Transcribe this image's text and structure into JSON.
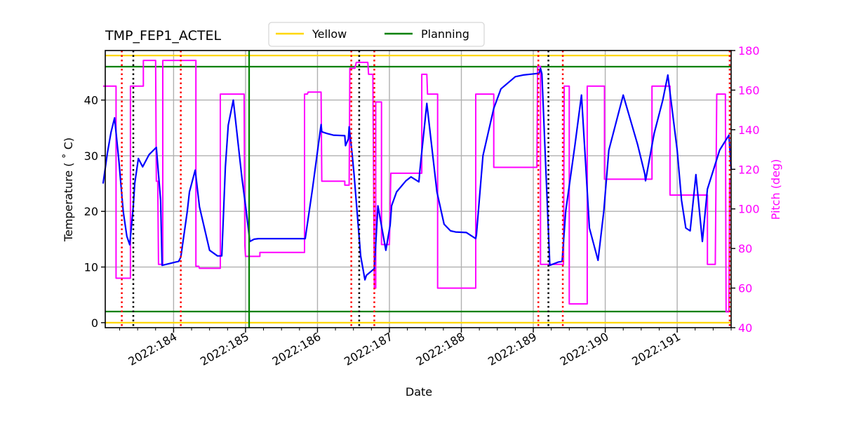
{
  "chart_data": {
    "type": "line",
    "title": "TMP_FEP1_ACTEL",
    "xlabel": "Date",
    "ylabel": "Temperature ($^\\circ$C)",
    "ylabel_display": "Temperature ( ˚ C)",
    "y2label": "Pitch (deg)",
    "xlim": [
      183.05,
      191.75
    ],
    "ylim": [
      -0.9,
      48.9
    ],
    "y2lim": [
      40,
      180
    ],
    "grid": true,
    "legend": {
      "placement": "top-center",
      "entries": [
        {
          "label": "Yellow",
          "color": "#ffd700"
        },
        {
          "label": "Planning",
          "color": "#008000"
        }
      ]
    },
    "x_ticks": [
      {
        "value": 184,
        "label": "2022:184"
      },
      {
        "value": 185,
        "label": "2022:185"
      },
      {
        "value": 186,
        "label": "2022:186"
      },
      {
        "value": 187,
        "label": "2022:187"
      },
      {
        "value": 188,
        "label": "2022:188"
      },
      {
        "value": 189,
        "label": "2022:189"
      },
      {
        "value": 190,
        "label": "2022:190"
      },
      {
        "value": 191,
        "label": "2022:191"
      }
    ],
    "x_minor_step": 0.25,
    "y_ticks": [
      0,
      10,
      20,
      30,
      40
    ],
    "y2_ticks": [
      40,
      60,
      80,
      100,
      120,
      140,
      160,
      180
    ],
    "limit_lines": [
      {
        "name": "yellow-high",
        "value": 48,
        "color": "#ffd700",
        "group": "Yellow"
      },
      {
        "name": "yellow-low",
        "value": 0,
        "color": "#ffd700",
        "group": "Yellow"
      },
      {
        "name": "planning-high",
        "value": 46,
        "color": "#008000",
        "group": "Planning"
      },
      {
        "name": "planning-low",
        "value": 2,
        "color": "#008000",
        "group": "Planning"
      }
    ],
    "vertical_markers": [
      {
        "x": 183.28,
        "style": "red-dotted"
      },
      {
        "x": 183.44,
        "style": "black-dotted"
      },
      {
        "x": 184.1,
        "style": "red-dotted"
      },
      {
        "x": 185.05,
        "style": "green-solid"
      },
      {
        "x": 186.47,
        "style": "red-dotted"
      },
      {
        "x": 186.58,
        "style": "black-dotted"
      },
      {
        "x": 186.79,
        "style": "red-dotted"
      },
      {
        "x": 189.07,
        "style": "red-dotted"
      },
      {
        "x": 189.21,
        "style": "black-dotted"
      },
      {
        "x": 189.41,
        "style": "red-dotted"
      },
      {
        "x": 191.73,
        "style": "red-dotted"
      }
    ],
    "series": [
      {
        "name": "TMP_FEP1_ACTEL",
        "axis": "left",
        "color": "#0000ff",
        "x": [
          183.02,
          183.08,
          183.13,
          183.18,
          183.24,
          183.3,
          183.35,
          183.39,
          183.44,
          183.46,
          183.51,
          183.57,
          183.66,
          183.76,
          183.82,
          183.84,
          184.03,
          184.07,
          184.1,
          184.19,
          184.22,
          184.3,
          184.36,
          184.5,
          184.61,
          184.67,
          184.72,
          184.76,
          184.83,
          184.95,
          184.99,
          185.01,
          185.06,
          185.12,
          185.18,
          185.2,
          185.3,
          185.5,
          185.83,
          185.93,
          186.05,
          186.06,
          186.13,
          186.22,
          186.38,
          186.39,
          186.43,
          186.44,
          186.48,
          186.51,
          186.6,
          186.66,
          186.68,
          186.79,
          186.84,
          186.95,
          187.01,
          187.03,
          187.1,
          187.23,
          187.3,
          187.41,
          187.42,
          187.46,
          187.52,
          187.66,
          187.76,
          187.85,
          187.92,
          188.07,
          188.2,
          188.21,
          188.3,
          188.45,
          188.55,
          188.75,
          188.86,
          189.08,
          189.1,
          189.12,
          189.23,
          189.35,
          189.4,
          189.45,
          189.58,
          189.67,
          189.73,
          189.78,
          189.9,
          189.98,
          190.05,
          190.25,
          190.45,
          190.55,
          190.56,
          190.68,
          190.8,
          190.87,
          191.0,
          191.06,
          191.12,
          191.18,
          191.26,
          191.35,
          191.42,
          191.59,
          191.72,
          191.75
        ],
        "values": [
          25.0,
          30.5,
          34.2,
          36.8,
          29.0,
          20.0,
          15.5,
          14.0,
          21.0,
          25.0,
          29.5,
          28.0,
          30.2,
          31.5,
          22.0,
          10.3,
          10.9,
          11.0,
          11.8,
          20.0,
          23.5,
          27.4,
          20.8,
          13.0,
          12.0,
          12.0,
          28.0,
          35.5,
          40.0,
          26.0,
          22.0,
          20.0,
          14.6,
          15.0,
          15.1,
          15.1,
          15.1,
          15.1,
          15.1,
          24.0,
          35.6,
          34.3,
          34.0,
          33.7,
          33.6,
          31.8,
          33.0,
          35.2,
          30.5,
          26.5,
          12.0,
          7.7,
          8.5,
          9.7,
          21.0,
          13.0,
          17.5,
          21.0,
          23.5,
          25.5,
          26.2,
          25.3,
          27.0,
          32.0,
          39.4,
          23.5,
          17.7,
          16.5,
          16.3,
          16.2,
          15.1,
          15.8,
          30.0,
          38.5,
          42.0,
          44.2,
          44.5,
          44.8,
          45.7,
          44.7,
          10.3,
          10.9,
          11.0,
          20.0,
          32.0,
          40.9,
          28.0,
          17.0,
          11.2,
          20.0,
          31.0,
          40.9,
          32.0,
          26.7,
          25.5,
          34.0,
          40.0,
          44.5,
          31.0,
          22.0,
          17.0,
          16.5,
          26.6,
          14.6,
          24.0,
          31.0,
          33.7,
          27.5
        ]
      },
      {
        "name": "Pitch",
        "axis": "right",
        "color": "#ff00ff",
        "x": [
          183.02,
          183.2,
          183.2,
          183.4,
          183.4,
          183.45,
          183.45,
          183.58,
          183.58,
          183.62,
          183.64,
          183.75,
          183.76,
          183.78,
          183.79,
          183.85,
          183.85,
          184.09,
          184.1,
          184.31,
          184.31,
          184.35,
          184.36,
          184.65,
          184.65,
          184.98,
          184.99,
          185.0,
          185.02,
          185.2,
          185.2,
          185.82,
          185.82,
          185.86,
          185.87,
          186.05,
          186.06,
          186.38,
          186.38,
          186.44,
          186.45,
          186.52,
          186.54,
          186.7,
          186.71,
          186.77,
          186.79,
          186.81,
          186.81,
          186.89,
          186.89,
          187.0,
          187.02,
          187.4,
          187.42,
          187.45,
          187.45,
          187.52,
          187.53,
          187.67,
          187.67,
          188.2,
          188.2,
          188.45,
          188.45,
          189.05,
          189.06,
          189.07,
          189.09,
          189.1,
          189.1,
          189.42,
          189.43,
          189.5,
          189.5,
          189.75,
          189.75,
          189.99,
          189.99,
          190.25,
          190.26,
          190.65,
          190.65,
          190.9,
          190.9,
          191.1,
          191.1,
          191.42,
          191.42,
          191.53,
          191.55,
          191.67,
          191.68,
          191.72,
          191.73,
          191.75
        ],
        "values": [
          162,
          162,
          65,
          65,
          162,
          162,
          162,
          162,
          175,
          175,
          175,
          175,
          114,
          114,
          72,
          72,
          175,
          175,
          175,
          175,
          71,
          71,
          70,
          70,
          158,
          158,
          82,
          76,
          76,
          76,
          78,
          78,
          158,
          158,
          159,
          159,
          114,
          114,
          112,
          112,
          171,
          171,
          174,
          174,
          168,
          168,
          60,
          60,
          154,
          154,
          82,
          82,
          118,
          118,
          118,
          118,
          168,
          168,
          158,
          158,
          60,
          60,
          158,
          158,
          121,
          121,
          172,
          172,
          172,
          172,
          72,
          72,
          162,
          162,
          52,
          52,
          162,
          162,
          115,
          115,
          115,
          115,
          162,
          162,
          107,
          107,
          107,
          107,
          72,
          72,
          158,
          158,
          48,
          48,
          115,
          115,
          171
        ]
      }
    ]
  }
}
